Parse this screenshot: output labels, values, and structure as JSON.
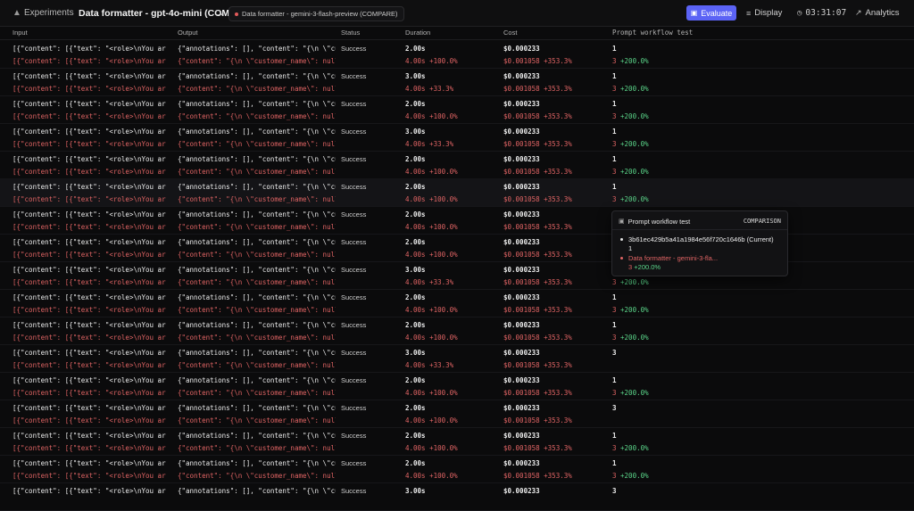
{
  "topbar": {
    "breadcrumb": "Experiments",
    "title": "Data formatter - gpt-4o-mini (COMP",
    "compare_label": "Data formatter - gemini-3-flash-preview (COMPARE)",
    "evaluate_label": "Evaluate",
    "display_label": "Display",
    "timer": "03:31:07",
    "analytics_label": "Analytics"
  },
  "columns": {
    "input": "Input",
    "output": "Output",
    "status": "Status",
    "duration": "Duration",
    "cost": "Cost",
    "prompt_workflow": "Prompt workflow test"
  },
  "rows": [
    {
      "input_a": "[{\"content\": [{\"text\": \"<role>\\nYou are a",
      "input_b": "[{\"content\": [{\"text\": \"<role>\\nYou are a",
      "output_a": "{\"annotations\": [], \"content\": \"{\\n \\\"cust",
      "output_b": "{\"content\": \"{\\n \\\"customer_name\\\": null,\\",
      "status": "Success",
      "dur_a": "2.00s",
      "dur_b": "4.00s +100.0%",
      "cost_a": "$0.000233",
      "cost_b": "$0.001058 +353.3%",
      "pw_a": "1",
      "pw_b_val": "3",
      "pw_b_delta": "+200.0%"
    },
    {
      "input_a": "[{\"content\": [{\"text\": \"<role>\\nYou are a",
      "input_b": "[{\"content\": [{\"text\": \"<role>\\nYou are a",
      "output_a": "{\"annotations\": [], \"content\": \"{\\n \\\"cust",
      "output_b": "{\"content\": \"{\\n \\\"customer_name\\\": null,\\",
      "status": "Success",
      "dur_a": "3.00s",
      "dur_b": "4.00s +33.3%",
      "cost_a": "$0.000233",
      "cost_b": "$0.001058 +353.3%",
      "pw_a": "1",
      "pw_b_val": "3",
      "pw_b_delta": "+200.0%"
    },
    {
      "input_a": "[{\"content\": [{\"text\": \"<role>\\nYou are a",
      "input_b": "[{\"content\": [{\"text\": \"<role>\\nYou are a",
      "output_a": "{\"annotations\": [], \"content\": \"{\\n \\\"cust",
      "output_b": "{\"content\": \"{\\n \\\"customer_name\\\": null,\\",
      "status": "Success",
      "dur_a": "2.00s",
      "dur_b": "4.00s +100.0%",
      "cost_a": "$0.000233",
      "cost_b": "$0.001058 +353.3%",
      "pw_a": "1",
      "pw_b_val": "3",
      "pw_b_delta": "+200.0%"
    },
    {
      "input_a": "[{\"content\": [{\"text\": \"<role>\\nYou are a",
      "input_b": "[{\"content\": [{\"text\": \"<role>\\nYou are a",
      "output_a": "{\"annotations\": [], \"content\": \"{\\n \\\"cust",
      "output_b": "{\"content\": \"{\\n \\\"customer_name\\\": null,\\",
      "status": "Success",
      "dur_a": "3.00s",
      "dur_b": "4.00s +33.3%",
      "cost_a": "$0.000233",
      "cost_b": "$0.001058 +353.3%",
      "pw_a": "1",
      "pw_b_val": "3",
      "pw_b_delta": "+200.0%"
    },
    {
      "input_a": "[{\"content\": [{\"text\": \"<role>\\nYou are a",
      "input_b": "[{\"content\": [{\"text\": \"<role>\\nYou are a",
      "output_a": "{\"annotations\": [], \"content\": \"{\\n \\\"cust",
      "output_b": "{\"content\": \"{\\n \\\"customer_name\\\": null,\\",
      "status": "Success",
      "dur_a": "2.00s",
      "dur_b": "4.00s +100.0%",
      "cost_a": "$0.000233",
      "cost_b": "$0.001058 +353.3%",
      "pw_a": "1",
      "pw_b_val": "3",
      "pw_b_delta": "+200.0%"
    },
    {
      "input_a": "[{\"content\": [{\"text\": \"<role>\\nYou are a",
      "input_b": "[{\"content\": [{\"text\": \"<role>\\nYou are a",
      "output_a": "{\"annotations\": [], \"content\": \"{\\n \\\"cust",
      "output_b": "{\"content\": \"{\\n \\\"customer_name\\\": null,\\",
      "status": "Success",
      "dur_a": "2.00s",
      "dur_b": "4.00s +100.0%",
      "cost_a": "$0.000233",
      "cost_b": "$0.001058 +353.3%",
      "pw_a": "1",
      "pw_b_val": "3",
      "pw_b_delta": "+200.0%"
    },
    {
      "input_a": "[{\"content\": [{\"text\": \"<role>\\nYou are a",
      "input_b": "[{\"content\": [{\"text\": \"<role>\\nYou are a",
      "output_a": "{\"annotations\": [], \"content\": \"{\\n \\\"cust",
      "output_b": "{\"content\": \"{\\n \\\"customer_name\\\": null,\\",
      "status": "Success",
      "dur_a": "2.00s",
      "dur_b": "4.00s +100.0%",
      "cost_a": "$0.000233",
      "cost_b": "$0.001058 +353.3%",
      "pw_a": "",
      "pw_b_val": "",
      "pw_b_delta": ""
    },
    {
      "input_a": "[{\"content\": [{\"text\": \"<role>\\nYou are a",
      "input_b": "[{\"content\": [{\"text\": \"<role>\\nYou are a",
      "output_a": "{\"annotations\": [], \"content\": \"{\\n \\\"cust",
      "output_b": "{\"content\": \"{\\n \\\"customer_name\\\": null,\\",
      "status": "Success",
      "dur_a": "2.00s",
      "dur_b": "4.00s +100.0%",
      "cost_a": "$0.000233",
      "cost_b": "$0.001058 +353.3%",
      "pw_a": "",
      "pw_b_val": "",
      "pw_b_delta": ""
    },
    {
      "input_a": "[{\"content\": [{\"text\": \"<role>\\nYou are a",
      "input_b": "[{\"content\": [{\"text\": \"<role>\\nYou are a",
      "output_a": "{\"annotations\": [], \"content\": \"{\\n \\\"cust",
      "output_b": "{\"content\": \"{\\n \\\"customer_name\\\": null,\\",
      "status": "Success",
      "dur_a": "3.00s",
      "dur_b": "4.00s +33.3%",
      "cost_a": "$0.000233",
      "cost_b": "$0.001058 +353.3%",
      "pw_a": "",
      "pw_b_val": "3",
      "pw_b_delta": "+200.0%"
    },
    {
      "input_a": "[{\"content\": [{\"text\": \"<role>\\nYou are a",
      "input_b": "[{\"content\": [{\"text\": \"<role>\\nYou are a",
      "output_a": "{\"annotations\": [], \"content\": \"{\\n \\\"cust",
      "output_b": "{\"content\": \"{\\n \\\"customer_name\\\": null,\\",
      "status": "Success",
      "dur_a": "2.00s",
      "dur_b": "4.00s +100.0%",
      "cost_a": "$0.000233",
      "cost_b": "$0.001058 +353.3%",
      "pw_a": "1",
      "pw_b_val": "3",
      "pw_b_delta": "+200.0%"
    },
    {
      "input_a": "[{\"content\": [{\"text\": \"<role>\\nYou are a",
      "input_b": "[{\"content\": [{\"text\": \"<role>\\nYou are a",
      "output_a": "{\"annotations\": [], \"content\": \"{\\n \\\"cust",
      "output_b": "{\"content\": \"{\\n \\\"customer_name\\\": null,\\",
      "status": "Success",
      "dur_a": "2.00s",
      "dur_b": "4.00s +100.0%",
      "cost_a": "$0.000233",
      "cost_b": "$0.001058 +353.3%",
      "pw_a": "1",
      "pw_b_val": "3",
      "pw_b_delta": "+200.0%"
    },
    {
      "input_a": "[{\"content\": [{\"text\": \"<role>\\nYou are a",
      "input_b": "[{\"content\": [{\"text\": \"<role>\\nYou are a",
      "output_a": "{\"annotations\": [], \"content\": \"{\\n \\\"cust",
      "output_b": "{\"content\": \"{\\n \\\"customer_name\\\": null,\\",
      "status": "Success",
      "dur_a": "3.00s",
      "dur_b": "4.00s +33.3%",
      "cost_a": "$0.000233",
      "cost_b": "$0.001058 +353.3%",
      "pw_a": "3",
      "pw_b_val": "",
      "pw_b_delta": ""
    },
    {
      "input_a": "[{\"content\": [{\"text\": \"<role>\\nYou are a",
      "input_b": "[{\"content\": [{\"text\": \"<role>\\nYou are a",
      "output_a": "{\"annotations\": [], \"content\": \"{\\n \\\"cust",
      "output_b": "{\"content\": \"{\\n \\\"customer_name\\\": null,\\",
      "status": "Success",
      "dur_a": "2.00s",
      "dur_b": "4.00s +100.0%",
      "cost_a": "$0.000233",
      "cost_b": "$0.001058 +353.3%",
      "pw_a": "1",
      "pw_b_val": "3",
      "pw_b_delta": "+200.0%"
    },
    {
      "input_a": "[{\"content\": [{\"text\": \"<role>\\nYou are a",
      "input_b": "[{\"content\": [{\"text\": \"<role>\\nYou are a",
      "output_a": "{\"annotations\": [], \"content\": \"{\\n \\\"cust",
      "output_b": "{\"content\": \"{\\n \\\"customer_name\\\": null,\\",
      "status": "Success",
      "dur_a": "2.00s",
      "dur_b": "4.00s +100.0%",
      "cost_a": "$0.000233",
      "cost_b": "$0.001058 +353.3%",
      "pw_a": "3",
      "pw_b_val": "",
      "pw_b_delta": ""
    },
    {
      "input_a": "[{\"content\": [{\"text\": \"<role>\\nYou are a",
      "input_b": "[{\"content\": [{\"text\": \"<role>\\nYou are a",
      "output_a": "{\"annotations\": [], \"content\": \"{\\n \\\"cust",
      "output_b": "{\"content\": \"{\\n \\\"customer_name\\\": null,\\",
      "status": "Success",
      "dur_a": "2.00s",
      "dur_b": "4.00s +100.0%",
      "cost_a": "$0.000233",
      "cost_b": "$0.001058 +353.3%",
      "pw_a": "1",
      "pw_b_val": "3",
      "pw_b_delta": "+200.0%"
    },
    {
      "input_a": "[{\"content\": [{\"text\": \"<role>\\nYou are a",
      "input_b": "[{\"content\": [{\"text\": \"<role>\\nYou are a",
      "output_a": "{\"annotations\": [], \"content\": \"{\\n \\\"cust",
      "output_b": "{\"content\": \"{\\n \\\"customer_name\\\": null,\\",
      "status": "Success",
      "dur_a": "2.00s",
      "dur_b": "4.00s +100.0%",
      "cost_a": "$0.000233",
      "cost_b": "$0.001058 +353.3%",
      "pw_a": "1",
      "pw_b_val": "3",
      "pw_b_delta": "+200.0%"
    },
    {
      "input_a": "[{\"content\": [{\"text\": \"<role>\\nYou are a",
      "input_b": "",
      "output_a": "{\"annotations\": [], \"content\": \"{\\n \\\"cust",
      "output_b": "",
      "status": "Success",
      "dur_a": "3.00s",
      "dur_b": "",
      "cost_a": "$0.000233",
      "cost_b": "",
      "pw_a": "3",
      "pw_b_val": "",
      "pw_b_delta": ""
    }
  ],
  "tooltip": {
    "title": "Prompt workflow test",
    "badge": "COMPARISON",
    "current_id": "3b61ec429b5a41a1984e56f720c1646b (Current)",
    "current_value": "1",
    "compare_name": "Data formatter - gemini-3-fla...",
    "compare_value": "3",
    "compare_delta": "+200.0%"
  },
  "colors": {
    "accent": "#5b63f5",
    "compare_red": "#e06464",
    "delta_green": "#5bd68a"
  }
}
